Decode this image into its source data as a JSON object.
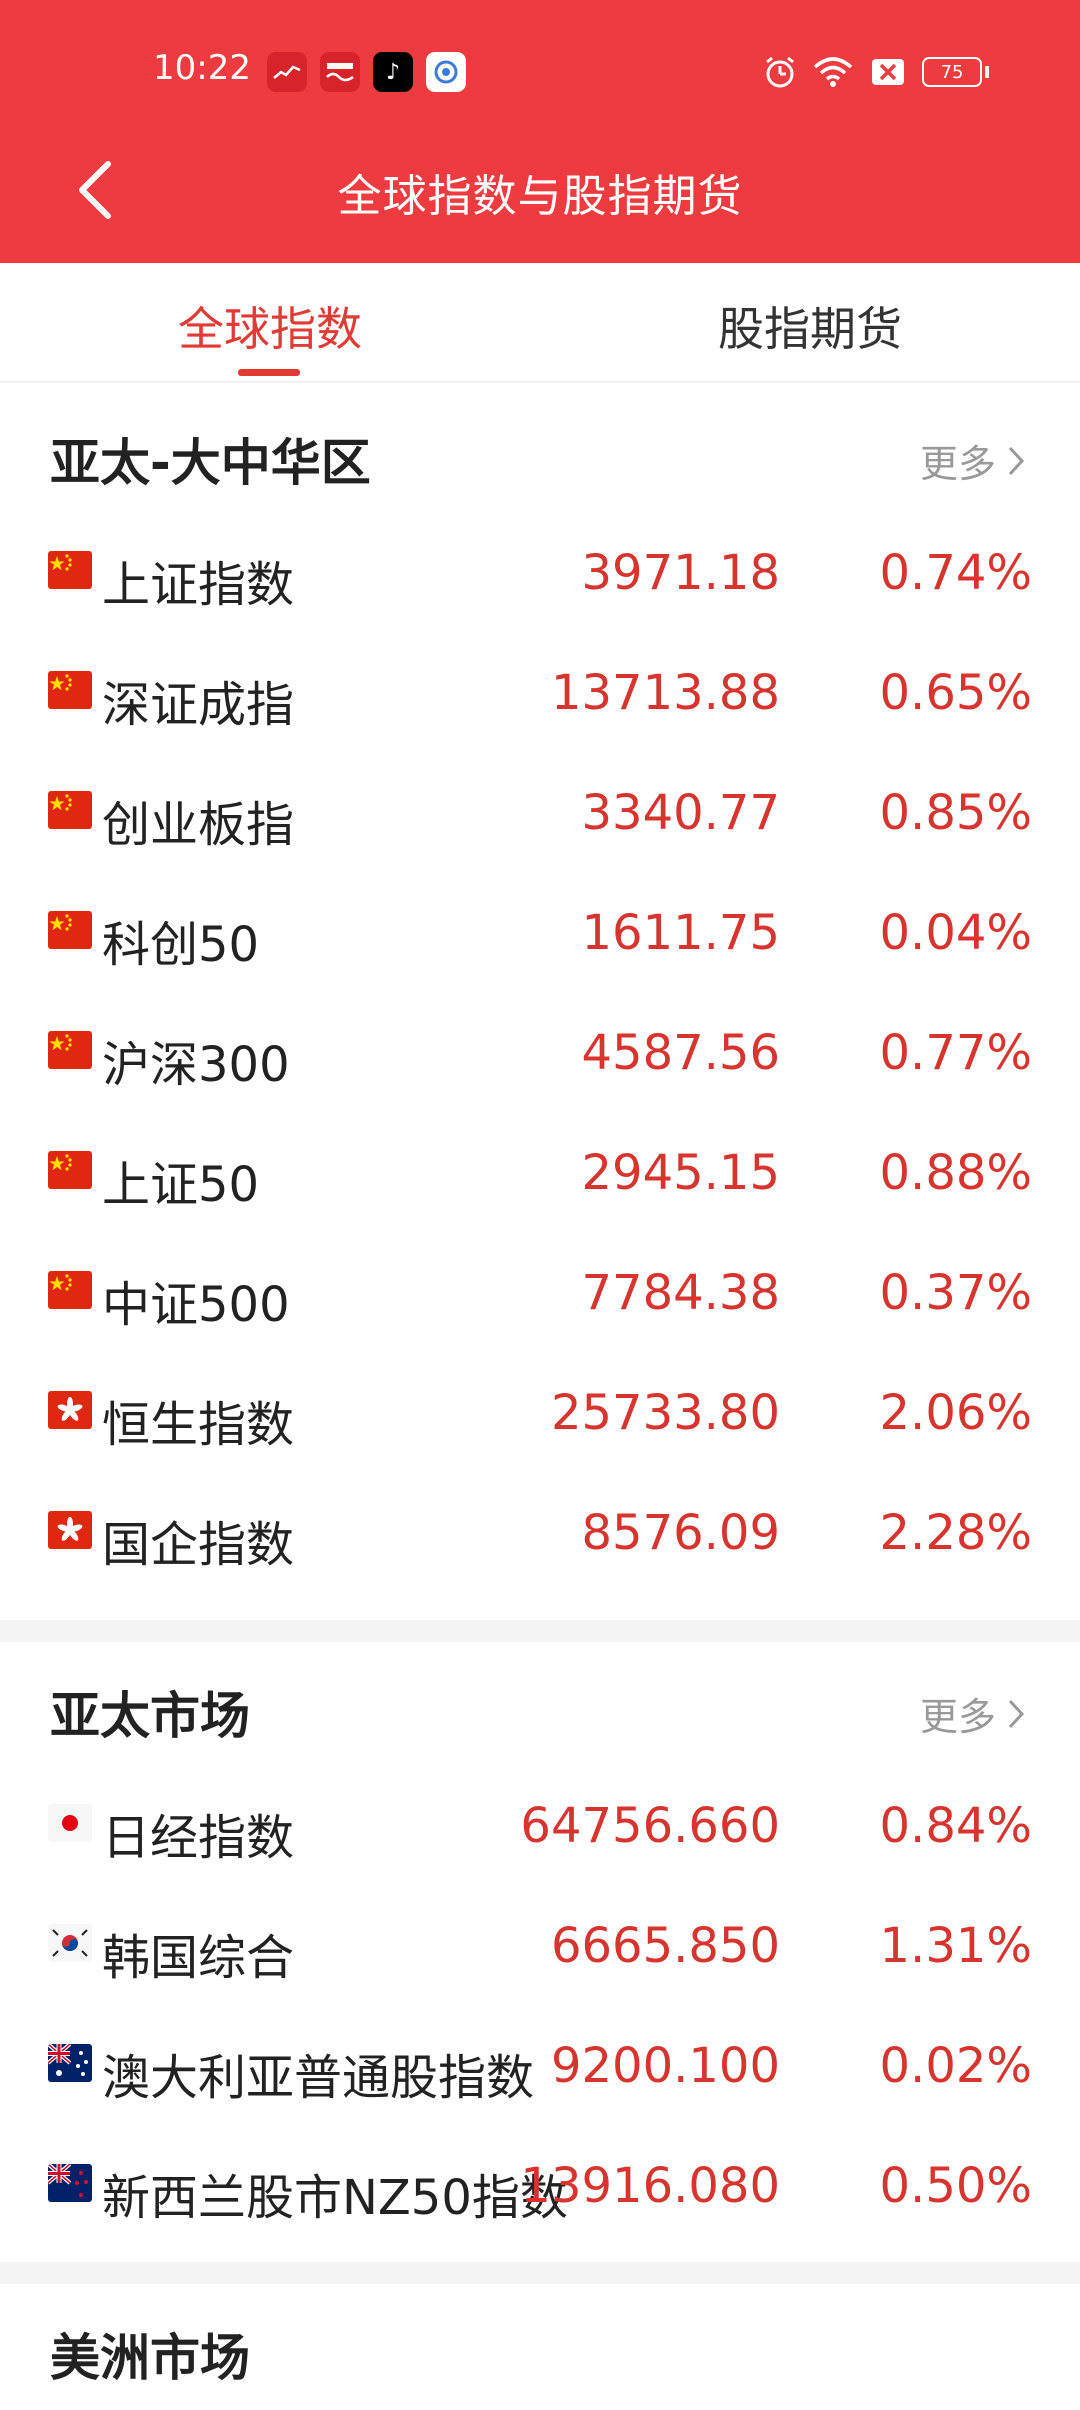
{
  "status_bar": {
    "time": "10:22",
    "battery": "75",
    "icons": [
      "stock-app-icon",
      "news-app-icon",
      "tiktok-icon",
      "browser-icon",
      "alarm-icon",
      "wifi-icon",
      "no-sim-icon",
      "battery-icon"
    ]
  },
  "header": {
    "title": "全球指数与股指期货",
    "back_icon": "chevron-left-icon"
  },
  "tabs": [
    {
      "label": "全球指数",
      "active": true
    },
    {
      "label": "股指期货",
      "active": false
    }
  ],
  "colors": {
    "brand_red": "#ee3b3f",
    "up_red": "#d8342e",
    "active_tab": "#e23a35"
  },
  "sections": [
    {
      "title": "亚太-大中华区",
      "more": "更多",
      "rows": [
        {
          "flag": "cn",
          "name": "上证指数",
          "price": "3971.18",
          "pct": "0.74%"
        },
        {
          "flag": "cn",
          "name": "深证成指",
          "price": "13713.88",
          "pct": "0.65%"
        },
        {
          "flag": "cn",
          "name": "创业板指",
          "price": "3340.77",
          "pct": "0.85%"
        },
        {
          "flag": "cn",
          "name": "科创50",
          "price": "1611.75",
          "pct": "0.04%"
        },
        {
          "flag": "cn",
          "name": "沪深300",
          "price": "4587.56",
          "pct": "0.77%"
        },
        {
          "flag": "cn",
          "name": "上证50",
          "price": "2945.15",
          "pct": "0.88%"
        },
        {
          "flag": "cn",
          "name": "中证500",
          "price": "7784.38",
          "pct": "0.37%"
        },
        {
          "flag": "hk",
          "name": "恒生指数",
          "price": "25733.80",
          "pct": "2.06%"
        },
        {
          "flag": "hk",
          "name": "国企指数",
          "price": "8576.09",
          "pct": "2.28%"
        }
      ]
    },
    {
      "title": "亚太市场",
      "more": "更多",
      "rows": [
        {
          "flag": "jp",
          "name": "日经指数",
          "price": "64756.660",
          "pct": "0.84%"
        },
        {
          "flag": "kr",
          "name": "韩国综合",
          "price": "6665.850",
          "pct": "1.31%"
        },
        {
          "flag": "au",
          "name": "澳大利亚普通股指数",
          "price": "9200.100",
          "pct": "0.02%"
        },
        {
          "flag": "nz",
          "name": "新西兰股市NZ50指数",
          "price": "13916.080",
          "pct": "0.50%"
        }
      ]
    },
    {
      "title": "美洲市场",
      "more": "",
      "rows": []
    }
  ]
}
